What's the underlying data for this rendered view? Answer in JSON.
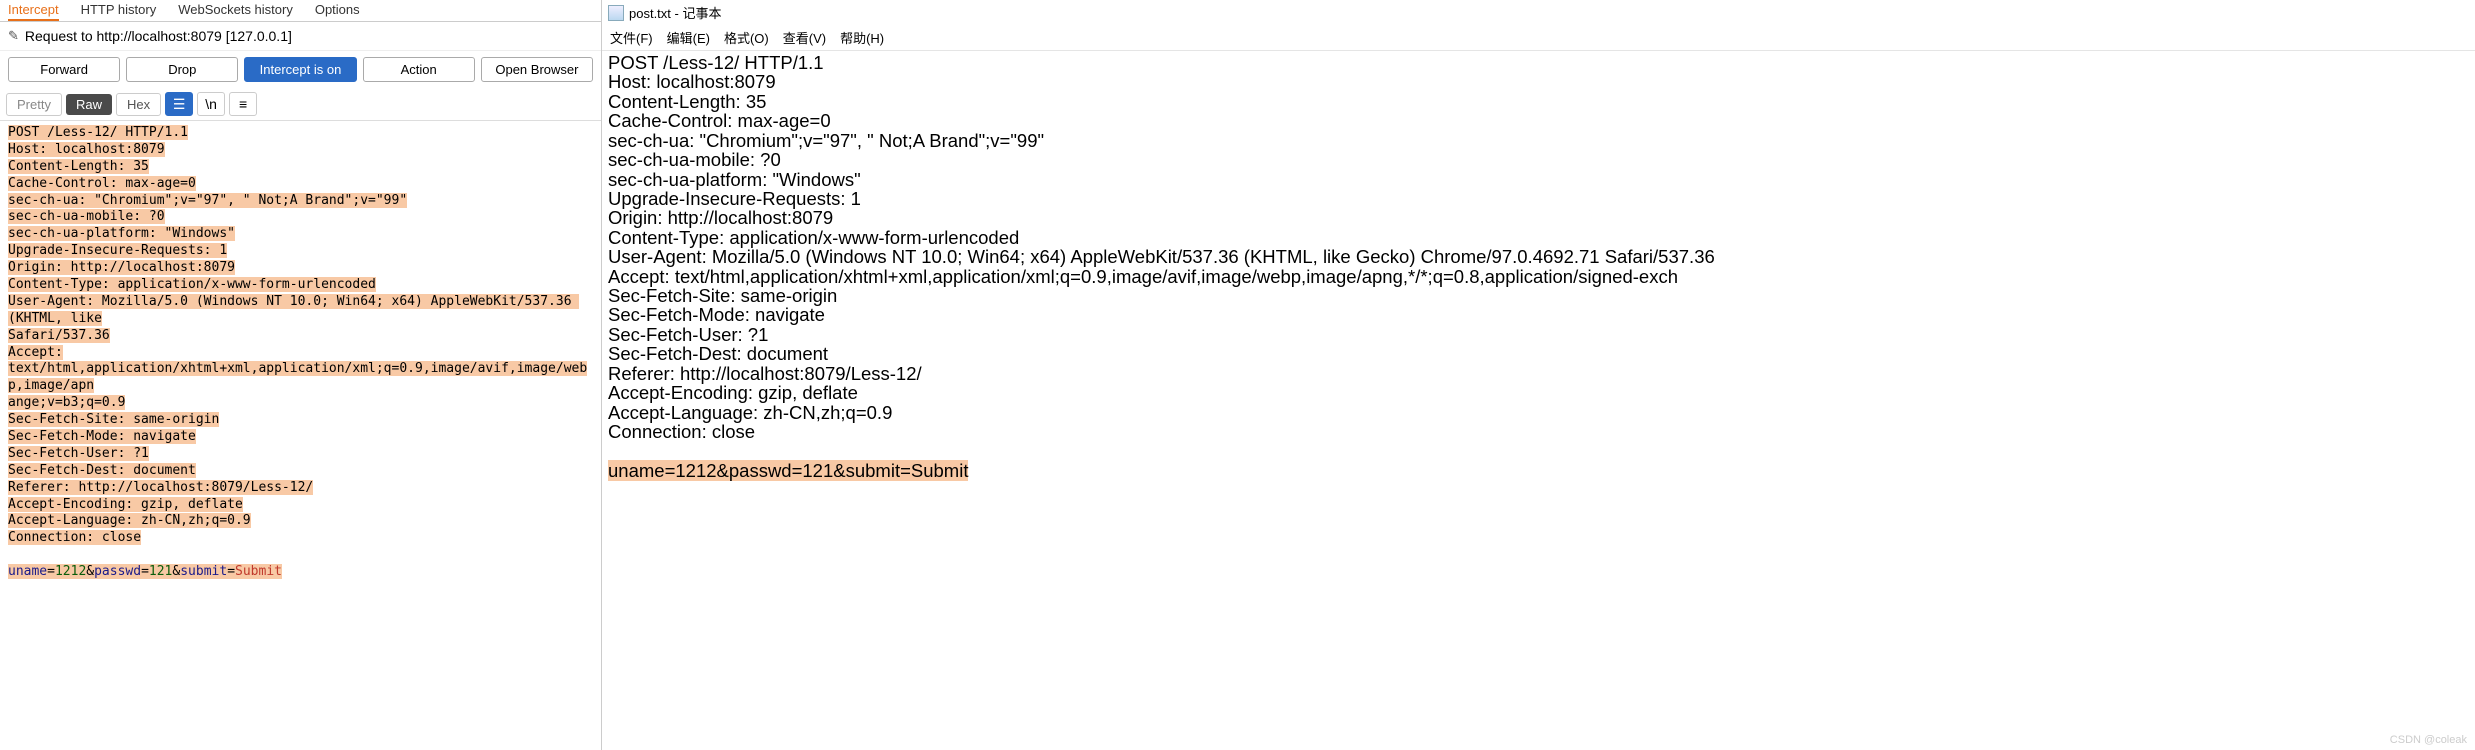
{
  "burp": {
    "tabs": [
      "Intercept",
      "HTTP history",
      "WebSockets history",
      "Options"
    ],
    "request_label": "Request to http://localhost:8079  [127.0.0.1]",
    "buttons": {
      "forward": "Forward",
      "drop": "Drop",
      "intercept": "Intercept is on",
      "action": "Action",
      "open": "Open Browser"
    },
    "etabs": {
      "pretty": "Pretty",
      "raw": "Raw",
      "hex": "Hex"
    },
    "raw_lines": [
      "POST /Less-12/ HTTP/1.1",
      "Host: localhost:8079",
      "Content-Length: 35",
      "Cache-Control: max-age=0",
      "sec-ch-ua: \"Chromium\";v=\"97\", \" Not;A Brand\";v=\"99\"",
      "sec-ch-ua-mobile: ?0",
      "sec-ch-ua-platform: \"Windows\"",
      "Upgrade-Insecure-Requests: 1",
      "Origin: http://localhost:8079",
      "Content-Type: application/x-www-form-urlencoded",
      "User-Agent: Mozilla/5.0 (Windows NT 10.0; Win64; x64) AppleWebKit/537.36 (KHTML, like",
      "Safari/537.36",
      "Accept:",
      "text/html,application/xhtml+xml,application/xml;q=0.9,image/avif,image/webp,image/apn",
      "ange;v=b3;q=0.9",
      "Sec-Fetch-Site: same-origin",
      "Sec-Fetch-Mode: navigate",
      "Sec-Fetch-User: ?1",
      "Sec-Fetch-Dest: document",
      "Referer: http://localhost:8079/Less-12/",
      "Accept-Encoding: gzip, deflate",
      "Accept-Language: zh-CN,zh;q=0.9",
      "Connection: close"
    ],
    "body": {
      "p1n": "uname",
      "p1v": "1212",
      "p2n": "passwd",
      "p2v": "121",
      "p3n": "submit",
      "p3v": "Submit"
    }
  },
  "notepad": {
    "title": "post.txt - 记事本",
    "menu": [
      "文件(F)",
      "编辑(E)",
      "格式(O)",
      "查看(V)",
      "帮助(H)"
    ],
    "lines": [
      "POST /Less-12/ HTTP/1.1",
      "Host: localhost:8079",
      "Content-Length: 35",
      "Cache-Control: max-age=0",
      "sec-ch-ua: \"Chromium\";v=\"97\", \" Not;A Brand\";v=\"99\"",
      "sec-ch-ua-mobile: ?0",
      "sec-ch-ua-platform: \"Windows\"",
      "Upgrade-Insecure-Requests: 1",
      "Origin: http://localhost:8079",
      "Content-Type: application/x-www-form-urlencoded",
      "User-Agent: Mozilla/5.0 (Windows NT 10.0; Win64; x64) AppleWebKit/537.36 (KHTML, like Gecko) Chrome/97.0.4692.71 Safari/537.36",
      "Accept: text/html,application/xhtml+xml,application/xml;q=0.9,image/avif,image/webp,image/apng,*/*;q=0.8,application/signed-exch",
      "Sec-Fetch-Site: same-origin",
      "Sec-Fetch-Mode: navigate",
      "Sec-Fetch-User: ?1",
      "Sec-Fetch-Dest: document",
      "Referer: http://localhost:8079/Less-12/",
      "Accept-Encoding: gzip, deflate",
      "Accept-Language: zh-CN,zh;q=0.9",
      "Connection: close",
      "",
      "uname=1212&passwd=121&submit=Submit"
    ],
    "body_line_index": 21
  },
  "watermark": "CSDN @coleak"
}
